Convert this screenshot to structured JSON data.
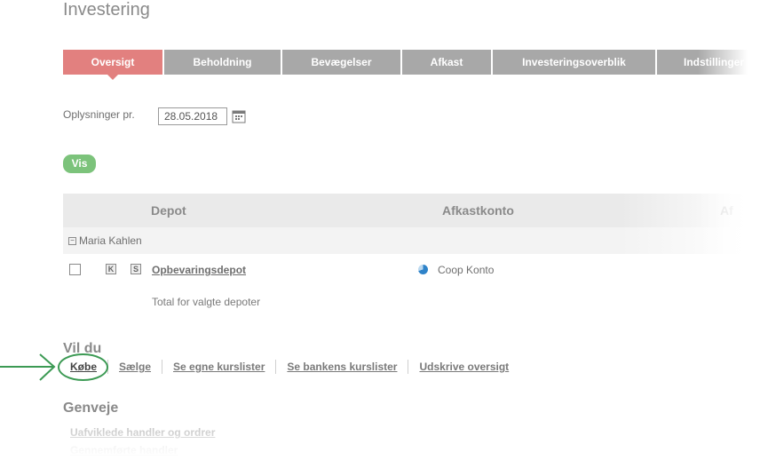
{
  "page": {
    "title": "Investering"
  },
  "tabs": [
    {
      "label": "Oversigt",
      "active": true
    },
    {
      "label": "Beholdning"
    },
    {
      "label": "Bevægelser"
    },
    {
      "label": "Afkast"
    },
    {
      "label": "Investeringsoverblik"
    },
    {
      "label": "Indstillinger"
    }
  ],
  "filter": {
    "date_label": "Oplysninger pr.",
    "date_value": "28.05.2018",
    "show_button": "Vis"
  },
  "table": {
    "headers": {
      "depot": "Depot",
      "afkastkonto": "Afkastkonto",
      "extra": "Af"
    },
    "group": {
      "toggle_symbol": "−",
      "name": "Maria Kahlen"
    },
    "row": {
      "badge_k": "K",
      "badge_s": "S",
      "depot": "Opbevaringsdepot",
      "afkastkonto": "Coop Konto"
    },
    "total_label": "Total for valgte depoter"
  },
  "vil_du": {
    "heading": "Vil du",
    "actions": [
      "Købe",
      "Sælge",
      "Se egne kurslister",
      "Se bankens kurslister",
      "Udskrive oversigt"
    ]
  },
  "genveje": {
    "heading": "Genveje",
    "links": [
      "Uafviklede handler og ordrer",
      "Gennemførte handler"
    ]
  },
  "colors": {
    "active_tab": "#e2807f",
    "inactive_tab": "#a8a8a8",
    "vis_button": "#7cc37b",
    "highlight": "#3c9a54"
  }
}
